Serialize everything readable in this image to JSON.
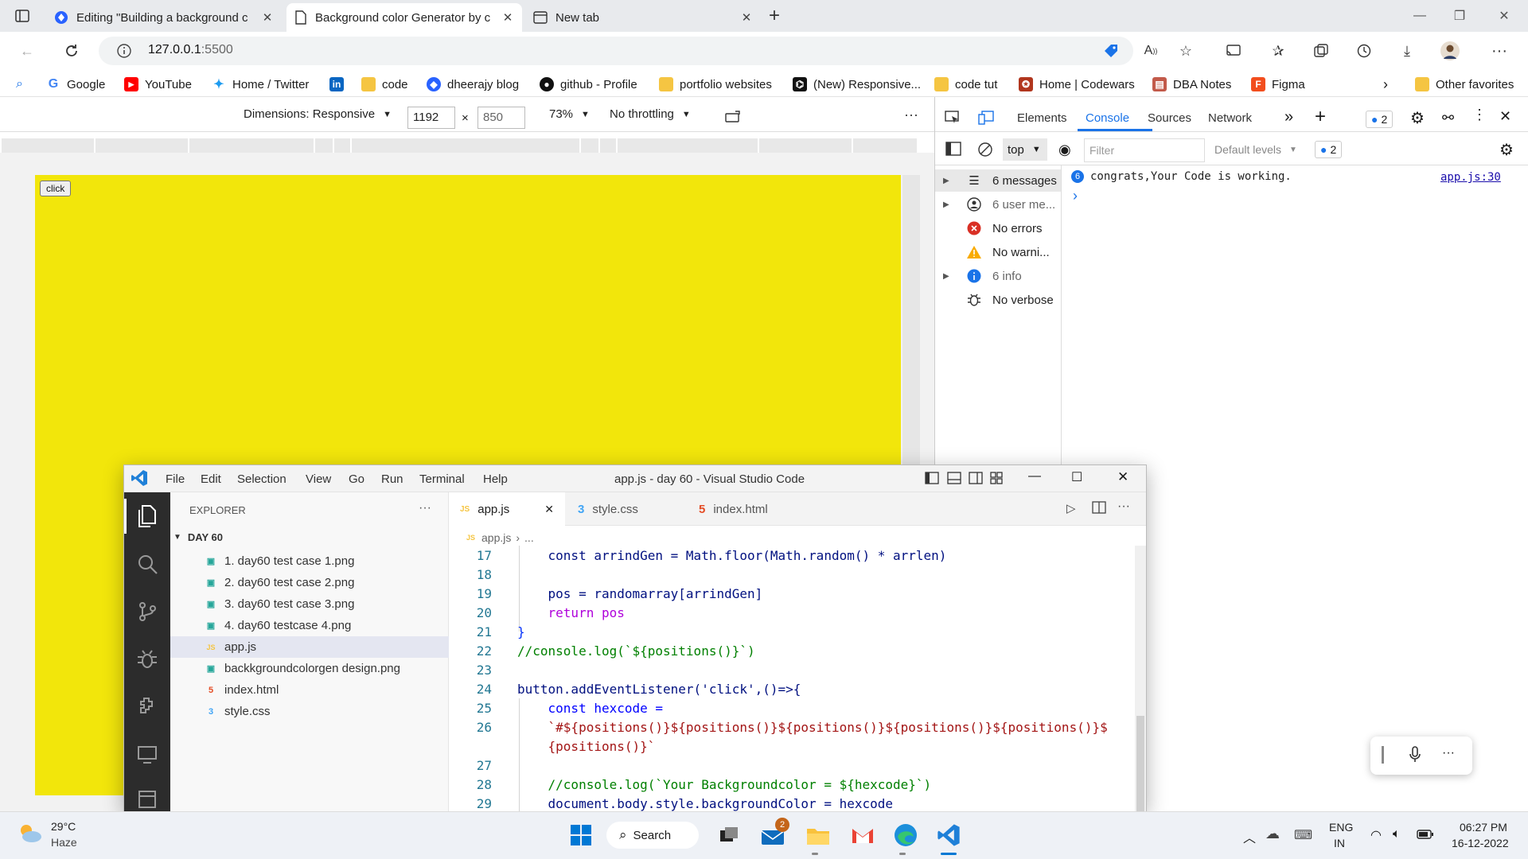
{
  "browser": {
    "tabs": [
      {
        "label": "Editing \"Building a background c",
        "active": false
      },
      {
        "label": "Background color Generator by c",
        "active": true
      },
      {
        "label": "New tab",
        "active": false
      }
    ],
    "address": {
      "host": "127.0.0.1",
      "port": ":5500"
    },
    "favorites": [
      {
        "label": "Google",
        "icon": "google-icon"
      },
      {
        "label": "YouTube",
        "icon": "youtube-icon"
      },
      {
        "label": "Home / Twitter",
        "icon": "twitter-icon"
      },
      {
        "label": "",
        "icon": "linkedin-icon"
      },
      {
        "label": "code",
        "icon": "folder-icon"
      },
      {
        "label": "dheerajy blog",
        "icon": "hashnode-icon"
      },
      {
        "label": "github - Profile",
        "icon": "github-icon"
      },
      {
        "label": "portfolio websites",
        "icon": "folder-icon"
      },
      {
        "label": "(New) Responsive...",
        "icon": "frontend-mentor-icon"
      },
      {
        "label": "code tut",
        "icon": "folder-icon"
      },
      {
        "label": "Home | Codewars",
        "icon": "codewars-icon"
      },
      {
        "label": "DBA Notes",
        "icon": "notes-icon"
      },
      {
        "label": "Figma",
        "icon": "figma-icon"
      }
    ],
    "other_favorites": "Other favorites"
  },
  "device_toolbar": {
    "dimensions": "Dimensions: Responsive",
    "width": "1192",
    "times": "×",
    "height": "850",
    "zoom": "73%",
    "throttle": "No throttling"
  },
  "page": {
    "button_label": "click",
    "background_color": "#f2e60b"
  },
  "devtools": {
    "tabs": [
      "Elements",
      "Console",
      "Sources",
      "Network"
    ],
    "active_tab": "Console",
    "issues_count": "2",
    "context": "top",
    "filter_placeholder": "Filter",
    "levels": "Default levels",
    "levels_issues": "2",
    "sidebar": [
      {
        "label": "6 messages",
        "icon": "list-icon",
        "expandable": true
      },
      {
        "label": "6 user me...",
        "icon": "user-icon",
        "expandable": true
      },
      {
        "label": "No errors",
        "icon": "error-icon",
        "expandable": false
      },
      {
        "label": "No warni...",
        "icon": "warning-icon",
        "expandable": false
      },
      {
        "label": "6 info",
        "icon": "info-icon",
        "expandable": true
      },
      {
        "label": "No verbose",
        "icon": "bug-icon",
        "expandable": false
      }
    ],
    "message": {
      "count": "6",
      "text": "congrats,Your Code is working.",
      "source": "app.js:30"
    },
    "prompt": "›"
  },
  "vscode": {
    "menu": [
      "File",
      "Edit",
      "Selection",
      "View",
      "Go",
      "Run",
      "Terminal",
      "Help"
    ],
    "title": "app.js - day 60 - Visual Studio Code",
    "explorer_title": "EXPLORER",
    "folder": "DAY 60",
    "files": [
      {
        "name": "1. day60 test case 1.png",
        "type": "img"
      },
      {
        "name": "2. day60 test case 2.png",
        "type": "img"
      },
      {
        "name": "3. day60 test case 3.png",
        "type": "img"
      },
      {
        "name": "4. day60 testcase 4.png",
        "type": "img"
      },
      {
        "name": "app.js",
        "type": "js",
        "selected": true
      },
      {
        "name": "backkgroundcolorgen design.png",
        "type": "img"
      },
      {
        "name": "index.html",
        "type": "html"
      },
      {
        "name": "style.css",
        "type": "css"
      }
    ],
    "editor_tabs": [
      {
        "name": "app.js",
        "type": "js",
        "active": true
      },
      {
        "name": "style.css",
        "type": "css"
      },
      {
        "name": "index.html",
        "type": "html"
      }
    ],
    "breadcrumb": {
      "file": "app.js",
      "sep": "›",
      "rest": "..."
    },
    "code_lines": [
      {
        "n": "17",
        "text": "    const arrindGen = Math.floor(Math.random() * arrlen)"
      },
      {
        "n": "18",
        "text": ""
      },
      {
        "n": "19",
        "text": "    pos = randomarray[arrindGen]"
      },
      {
        "n": "20",
        "text": "    return pos"
      },
      {
        "n": "21",
        "text": "}"
      },
      {
        "n": "22",
        "text": "//console.log(`${positions()}`)"
      },
      {
        "n": "23",
        "text": ""
      },
      {
        "n": "24",
        "text": "button.addEventListener('click',()=>{"
      },
      {
        "n": "25",
        "text": "    const hexcode ="
      },
      {
        "n": "26",
        "text": "    `#${positions()}${positions()}${positions()}${positions()}${positions()}$"
      },
      {
        "n": "",
        "text": "    {positions()}`"
      },
      {
        "n": "27",
        "text": ""
      },
      {
        "n": "28",
        "text": "    //console.log(`Your Backgroundcolor = ${hexcode}`)"
      },
      {
        "n": "29",
        "text": "    document.body.style.backgroundColor = hexcode"
      }
    ]
  },
  "taskbar": {
    "weather_temp": "29°C",
    "weather_desc": "Haze",
    "search": "Search",
    "mail_badge": "2",
    "lang": "ENG",
    "region": "IN",
    "time": "06:27 PM",
    "date": "16-12-2022"
  }
}
